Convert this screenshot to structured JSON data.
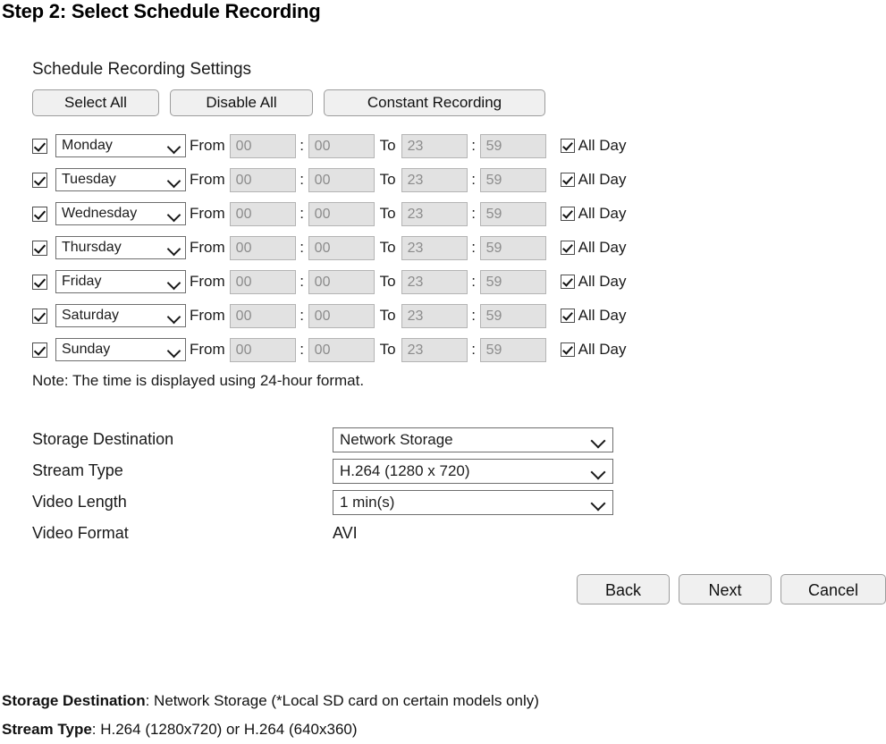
{
  "page_title": "Step 2: Select Schedule Recording",
  "panel": {
    "title": "Schedule Recording Settings",
    "buttons": {
      "select_all": "Select All",
      "disable_all": "Disable All",
      "constant_recording": "Constant Recording"
    },
    "labels": {
      "from": "From",
      "to": "To",
      "colon": ":",
      "all_day": "All Day"
    },
    "schedule_rows": [
      {
        "enabled": true,
        "day": "Monday",
        "from_hour": "00",
        "from_min": "00",
        "to_hour": "23",
        "to_min": "59",
        "all_day": true
      },
      {
        "enabled": true,
        "day": "Tuesday",
        "from_hour": "00",
        "from_min": "00",
        "to_hour": "23",
        "to_min": "59",
        "all_day": true
      },
      {
        "enabled": true,
        "day": "Wednesday",
        "from_hour": "00",
        "from_min": "00",
        "to_hour": "23",
        "to_min": "59",
        "all_day": true
      },
      {
        "enabled": true,
        "day": "Thursday",
        "from_hour": "00",
        "from_min": "00",
        "to_hour": "23",
        "to_min": "59",
        "all_day": true
      },
      {
        "enabled": true,
        "day": "Friday",
        "from_hour": "00",
        "from_min": "00",
        "to_hour": "23",
        "to_min": "59",
        "all_day": true
      },
      {
        "enabled": true,
        "day": "Saturday",
        "from_hour": "00",
        "from_min": "00",
        "to_hour": "23",
        "to_min": "59",
        "all_day": true
      },
      {
        "enabled": true,
        "day": "Sunday",
        "from_hour": "00",
        "from_min": "00",
        "to_hour": "23",
        "to_min": "59",
        "all_day": true
      }
    ],
    "note": "Note: The time is displayed using 24-hour format.",
    "settings": {
      "storage_destination_label": "Storage Destination",
      "storage_destination_value": "Network Storage",
      "stream_type_label": "Stream Type",
      "stream_type_value": "H.264 (1280 x 720)",
      "video_length_label": "Video Length",
      "video_length_value": "1 min(s)",
      "video_format_label": "Video Format",
      "video_format_value": "AVI"
    },
    "nav_buttons": {
      "back": "Back",
      "next": "Next",
      "cancel": "Cancel"
    }
  },
  "footer": {
    "line1_bold": "Storage Destination",
    "line1_rest": ": Network Storage (*Local SD card on certain models only)",
    "line2_bold": "Stream Type",
    "line2_rest": ": H.264 (1280x720) or H.264 (640x360)"
  },
  "colors": {
    "panel_border": "#6e6e6e",
    "button_face": "#f0f0f0",
    "button_border": "#9c9c9c",
    "disabled_field_bg": "#e2e2e2",
    "disabled_field_text": "#8c8c8c",
    "text": "#1a1a1a"
  }
}
